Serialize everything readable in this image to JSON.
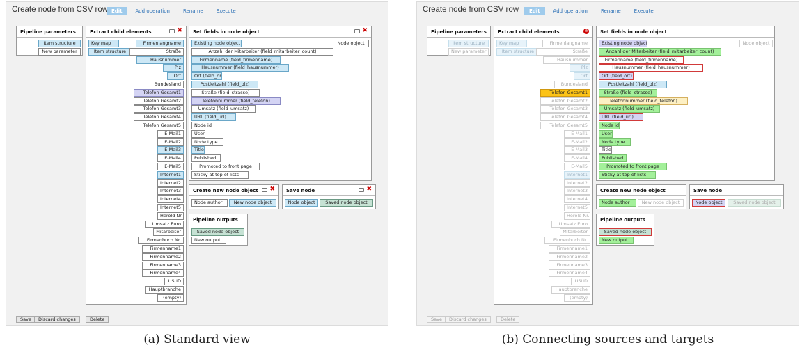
{
  "app_title": "Create node from CSV row",
  "tabs": [
    "Edit",
    "Add operation",
    "Rename",
    "Execute"
  ],
  "buttons": {
    "save": "Save",
    "discard": "Discard changes",
    "delete": "Delete"
  },
  "panels": {
    "pipeline_parameters": {
      "title": "Pipeline parameters",
      "items": [
        "Item structure",
        "New parameter"
      ]
    },
    "extract_child_elements": {
      "title": "Extract child elements",
      "key_map": "Key map",
      "item_structure": "Item structure",
      "items": [
        "Firmenlangname",
        "Straße",
        "Hausnummer",
        "Plz",
        "Ort",
        "Bundesland",
        "Telefon Gesamt1",
        "Telefon Gesamt2",
        "Telefon Gesamt3",
        "Telefon Gesamt4",
        "Telefon Gesamt5",
        "E-Mail1",
        "E-Mail2",
        "E-Mail3",
        "E-Mail4",
        "E-Mail5",
        "Internet1",
        "Internet2",
        "Internet3",
        "Internet4",
        "Internet5",
        "Herold Nr.",
        "Umsatz Euro",
        "Mitarbeiter",
        "Firmenbuch Nr.",
        "Firmenname1",
        "Firmenname2",
        "Firmenname3",
        "Firmenname4",
        "UStID",
        "Hauptbranche",
        "(empty)"
      ]
    },
    "set_fields": {
      "title": "Set fields in node object",
      "node_object": "Node object",
      "items": [
        "Existing node object",
        "Anzahl der Mitarbeiter (field_mitarbeiter_count)",
        "Firmenname (field_firmenname)",
        "Hausnummer (field_hausnummer)",
        "Ort (field_ort)",
        "Postleitzahl (field_plz)",
        "Straße (field_strasse)",
        "Telefonnummer (field_telefon)",
        "Umsatz (field_umsatz)",
        "URL (field_url)",
        "Node id",
        "User",
        "Node type",
        "Title",
        "Published",
        "Promoted to front page",
        "Sticky at top of lists"
      ]
    },
    "create_new_node": {
      "title": "Create new node object",
      "items": [
        "Node author",
        "New node object"
      ]
    },
    "save_node": {
      "title": "Save node",
      "items": [
        "Node object",
        "Saved node object"
      ]
    },
    "pipeline_outputs": {
      "title": "Pipeline outputs",
      "items": [
        "Saved node object",
        "New output"
      ]
    }
  },
  "captions": {
    "a": "(a) Standard view",
    "b": "(b) Connecting sources and targets"
  }
}
